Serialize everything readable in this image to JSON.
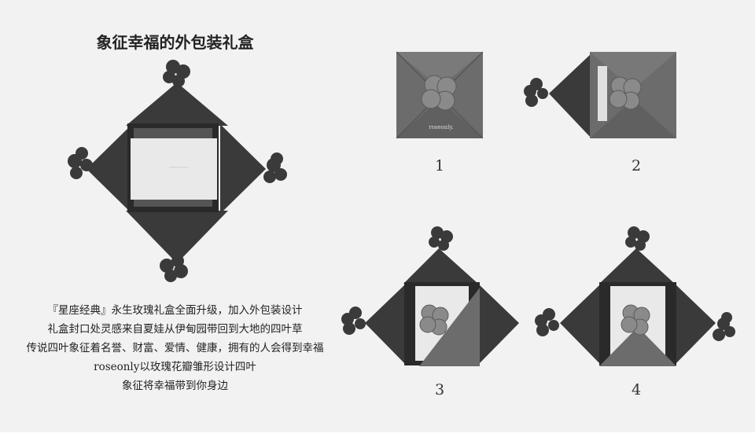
{
  "title": "象征幸福的外包装礼盒",
  "description": [
    "『星座经典』永生玫瑰礼盒全面升级，加入外包装设计",
    "礼盒封口处灵感来自夏娃从伊甸园带回到大地的四叶草",
    "传说四叶象征着名誉、财富、爱情、健康，拥有的人会得到幸福",
    "roseonly以玫瑰花瓣雏形设计四叶",
    "象征将幸福带到你身边"
  ],
  "box_brand": "roseonly.",
  "steps": [
    "1",
    "2",
    "3",
    "4"
  ],
  "colors": {
    "background": "#f2f2f2",
    "dark_flap": "#3a3a3a",
    "mid_flap": "#6c6c6c",
    "inner_box": "#e9e9e9",
    "text": "#222222"
  }
}
